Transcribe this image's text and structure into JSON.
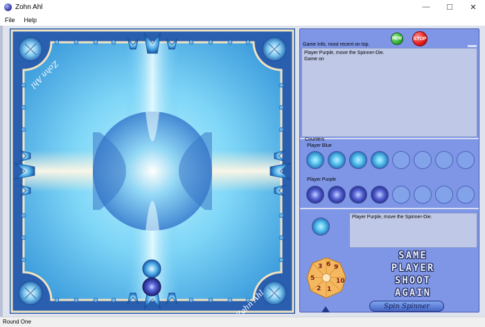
{
  "window": {
    "title": "Zohn Ahl",
    "min_glyph": "—",
    "max_glyph": "☐",
    "close_glyph": "✕"
  },
  "menu": {
    "items": [
      "File",
      "Help"
    ]
  },
  "board": {
    "corner_text_top": "Zohn Ahl",
    "corner_text_bottom": "Zohn Ahl"
  },
  "panel": {
    "new_label": "NEW",
    "stop_label": "STOP",
    "game_info_label": "Game Info, most recent on top.",
    "game_info_lines": [
      "Player Purple, move the Spinner-Die.",
      "Game on"
    ],
    "counters_label": "Counters",
    "player_blue_label": "Player Blue",
    "player_purple_label": "Player Purple",
    "blue_counters_remaining": 4,
    "purple_counters_remaining": 4,
    "counter_slots": 8,
    "status_message": "Player Purple, move the Spinner-Die.",
    "big_message_lines": [
      "SAME",
      "PLAYER",
      "SHOOT",
      "AGAIN"
    ],
    "spin_button_label": "Spin Spinner",
    "spinner_numbers": [
      "3",
      "6",
      "9",
      "10",
      "1",
      "2",
      "5"
    ]
  },
  "statusbar": {
    "text": "Round One"
  },
  "colors": {
    "panel_bg": "#7f96e6",
    "board_blue": "#2a5fb0",
    "player_blue": "#3da6e3",
    "player_purple": "#3a3fb2",
    "new_green": "#2da82c",
    "stop_red": "#e01818"
  }
}
